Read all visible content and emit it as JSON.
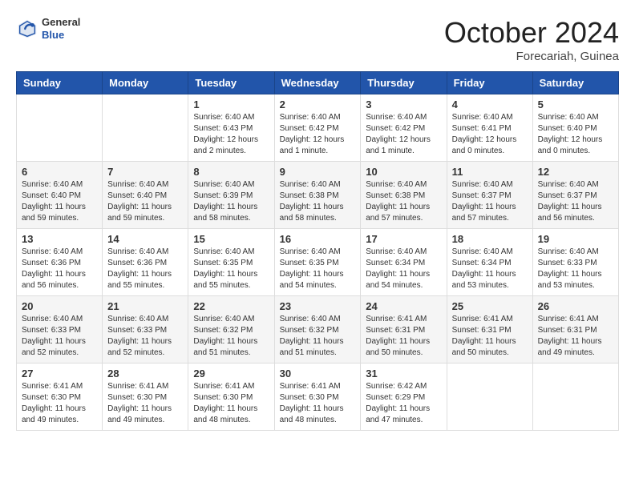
{
  "header": {
    "logo_general": "General",
    "logo_blue": "Blue",
    "month_title": "October 2024",
    "location": "Forecariah, Guinea"
  },
  "weekdays": [
    "Sunday",
    "Monday",
    "Tuesday",
    "Wednesday",
    "Thursday",
    "Friday",
    "Saturday"
  ],
  "weeks": [
    [
      {
        "day": "",
        "content": ""
      },
      {
        "day": "",
        "content": ""
      },
      {
        "day": "1",
        "content": "Sunrise: 6:40 AM\nSunset: 6:43 PM\nDaylight: 12 hours and 2 minutes."
      },
      {
        "day": "2",
        "content": "Sunrise: 6:40 AM\nSunset: 6:42 PM\nDaylight: 12 hours and 1 minute."
      },
      {
        "day": "3",
        "content": "Sunrise: 6:40 AM\nSunset: 6:42 PM\nDaylight: 12 hours and 1 minute."
      },
      {
        "day": "4",
        "content": "Sunrise: 6:40 AM\nSunset: 6:41 PM\nDaylight: 12 hours and 0 minutes."
      },
      {
        "day": "5",
        "content": "Sunrise: 6:40 AM\nSunset: 6:40 PM\nDaylight: 12 hours and 0 minutes."
      }
    ],
    [
      {
        "day": "6",
        "content": "Sunrise: 6:40 AM\nSunset: 6:40 PM\nDaylight: 11 hours and 59 minutes."
      },
      {
        "day": "7",
        "content": "Sunrise: 6:40 AM\nSunset: 6:40 PM\nDaylight: 11 hours and 59 minutes."
      },
      {
        "day": "8",
        "content": "Sunrise: 6:40 AM\nSunset: 6:39 PM\nDaylight: 11 hours and 58 minutes."
      },
      {
        "day": "9",
        "content": "Sunrise: 6:40 AM\nSunset: 6:38 PM\nDaylight: 11 hours and 58 minutes."
      },
      {
        "day": "10",
        "content": "Sunrise: 6:40 AM\nSunset: 6:38 PM\nDaylight: 11 hours and 57 minutes."
      },
      {
        "day": "11",
        "content": "Sunrise: 6:40 AM\nSunset: 6:37 PM\nDaylight: 11 hours and 57 minutes."
      },
      {
        "day": "12",
        "content": "Sunrise: 6:40 AM\nSunset: 6:37 PM\nDaylight: 11 hours and 56 minutes."
      }
    ],
    [
      {
        "day": "13",
        "content": "Sunrise: 6:40 AM\nSunset: 6:36 PM\nDaylight: 11 hours and 56 minutes."
      },
      {
        "day": "14",
        "content": "Sunrise: 6:40 AM\nSunset: 6:36 PM\nDaylight: 11 hours and 55 minutes."
      },
      {
        "day": "15",
        "content": "Sunrise: 6:40 AM\nSunset: 6:35 PM\nDaylight: 11 hours and 55 minutes."
      },
      {
        "day": "16",
        "content": "Sunrise: 6:40 AM\nSunset: 6:35 PM\nDaylight: 11 hours and 54 minutes."
      },
      {
        "day": "17",
        "content": "Sunrise: 6:40 AM\nSunset: 6:34 PM\nDaylight: 11 hours and 54 minutes."
      },
      {
        "day": "18",
        "content": "Sunrise: 6:40 AM\nSunset: 6:34 PM\nDaylight: 11 hours and 53 minutes."
      },
      {
        "day": "19",
        "content": "Sunrise: 6:40 AM\nSunset: 6:33 PM\nDaylight: 11 hours and 53 minutes."
      }
    ],
    [
      {
        "day": "20",
        "content": "Sunrise: 6:40 AM\nSunset: 6:33 PM\nDaylight: 11 hours and 52 minutes."
      },
      {
        "day": "21",
        "content": "Sunrise: 6:40 AM\nSunset: 6:33 PM\nDaylight: 11 hours and 52 minutes."
      },
      {
        "day": "22",
        "content": "Sunrise: 6:40 AM\nSunset: 6:32 PM\nDaylight: 11 hours and 51 minutes."
      },
      {
        "day": "23",
        "content": "Sunrise: 6:40 AM\nSunset: 6:32 PM\nDaylight: 11 hours and 51 minutes."
      },
      {
        "day": "24",
        "content": "Sunrise: 6:41 AM\nSunset: 6:31 PM\nDaylight: 11 hours and 50 minutes."
      },
      {
        "day": "25",
        "content": "Sunrise: 6:41 AM\nSunset: 6:31 PM\nDaylight: 11 hours and 50 minutes."
      },
      {
        "day": "26",
        "content": "Sunrise: 6:41 AM\nSunset: 6:31 PM\nDaylight: 11 hours and 49 minutes."
      }
    ],
    [
      {
        "day": "27",
        "content": "Sunrise: 6:41 AM\nSunset: 6:30 PM\nDaylight: 11 hours and 49 minutes."
      },
      {
        "day": "28",
        "content": "Sunrise: 6:41 AM\nSunset: 6:30 PM\nDaylight: 11 hours and 49 minutes."
      },
      {
        "day": "29",
        "content": "Sunrise: 6:41 AM\nSunset: 6:30 PM\nDaylight: 11 hours and 48 minutes."
      },
      {
        "day": "30",
        "content": "Sunrise: 6:41 AM\nSunset: 6:30 PM\nDaylight: 11 hours and 48 minutes."
      },
      {
        "day": "31",
        "content": "Sunrise: 6:42 AM\nSunset: 6:29 PM\nDaylight: 11 hours and 47 minutes."
      },
      {
        "day": "",
        "content": ""
      },
      {
        "day": "",
        "content": ""
      }
    ]
  ]
}
